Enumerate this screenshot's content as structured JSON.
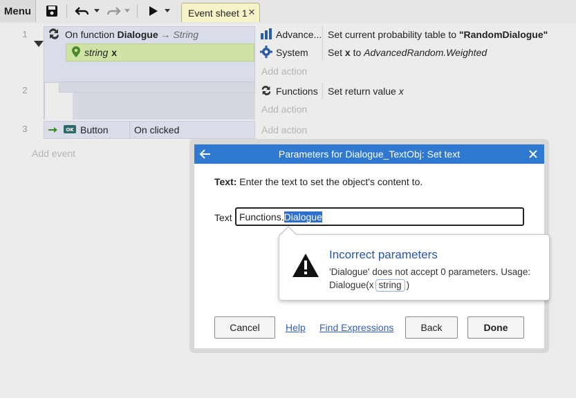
{
  "toolbar": {
    "menu_label": "Menu",
    "tab_label": "Event sheet 1"
  },
  "events": [
    {
      "number": "1",
      "condition_prefix": "On function ",
      "condition_name": "Dialogue",
      "condition_suffix": " → String",
      "param_type": "string",
      "param_name": "x",
      "actions": [
        {
          "object": "Advance...",
          "text_prefix": "Set current probability table to ",
          "text_value": "\"RandomDialogue\""
        },
        {
          "object": "System",
          "text_prefix": "Set ",
          "text_bold": "x",
          "text_mid": " to ",
          "text_italic": "AdvancedRandom.Weighted"
        }
      ],
      "add_action": "Add action"
    },
    {
      "number": "2",
      "actions": [
        {
          "object": "Functions",
          "text_prefix": "Set return value ",
          "text_italic": "x"
        }
      ],
      "add_action": "Add action"
    },
    {
      "number": "3",
      "object": "Button",
      "condition": "On clicked",
      "add_action": "Add action"
    }
  ],
  "add_event": "Add event",
  "dialog": {
    "title": "Parameters for Dialogue_TextObj: Set text",
    "desc_label": "Text:",
    "desc_text": " Enter the text to set the object's content to.",
    "field_label": "Text",
    "input_prefix": "Functions.",
    "input_selected": "Dialogue",
    "error": {
      "title": "Incorrect parameters",
      "message": "'Dialogue' does not accept 0 parameters. Usage: Dialogue(x",
      "pill": "string",
      "message_end": ")"
    },
    "buttons": {
      "cancel": "Cancel",
      "help": "Help",
      "find": "Find Expressions",
      "back": "Back",
      "done": "Done"
    }
  },
  "colors": {
    "accent": "#2f7ad0",
    "tab_bg": "#f7f3c8",
    "param_bg": "#cfe3a4",
    "error_title": "#2a55a8"
  }
}
